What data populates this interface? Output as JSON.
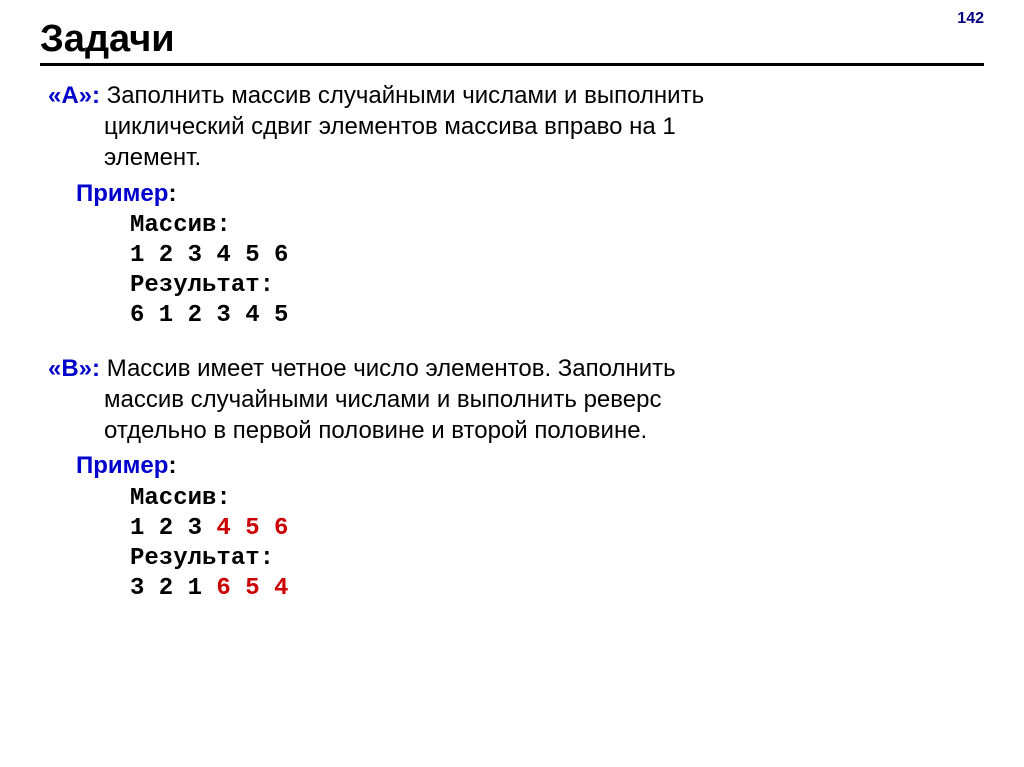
{
  "pageNumber": "142",
  "heading": "Задачи",
  "taskA": {
    "label": "«A»:",
    "desc_part1": " Заполнить массив случайными числами и выполнить",
    "desc_line2": "циклический сдвиг элементов массива вправо на 1",
    "desc_line3": "элемент."
  },
  "exampleLabel": "Пример:",
  "codeA": {
    "line1": "Массив:",
    "line2": "1 2 3 4 5 6",
    "line3": "Результат:",
    "line4": "6 1 2 3 4 5"
  },
  "taskB": {
    "label": "«B»:",
    "desc_part1": " Массив имеет четное число элементов. Заполнить",
    "desc_line2": "массив случайными числами и выполнить реверс",
    "desc_line3": "отдельно в первой половине и второй половине."
  },
  "codeB": {
    "line1": "Массив:",
    "line2_black": "1 2 3 ",
    "line2_red": "4 5 6",
    "line3": "Результат:",
    "line4_black": "3 2 1 ",
    "line4_red": "6 5 4"
  }
}
